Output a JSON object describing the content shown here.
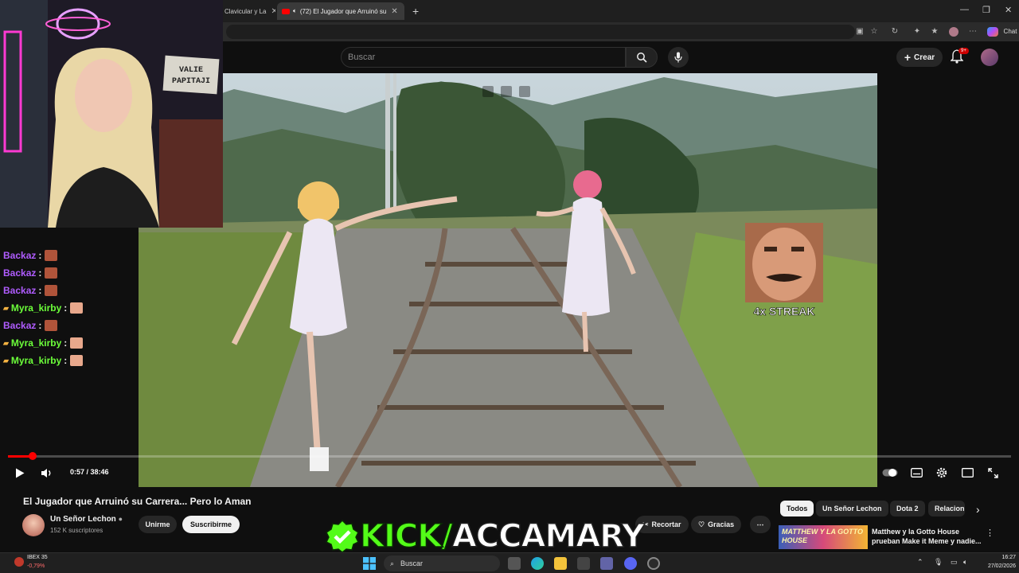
{
  "browser": {
    "tabs": [
      {
        "label": "Clavicular y La",
        "active": false
      },
      {
        "label": "(72) El Jugador que Arruinó su",
        "active": true
      }
    ],
    "new_tab_icon": "plus-icon",
    "chat_label": "Chat"
  },
  "youtube": {
    "search_placeholder": "Buscar",
    "create_label": "Crear",
    "notifications_badge": "9+"
  },
  "video": {
    "overlay_streak_text": "4x STREAK",
    "time_display": "0:57 / 38:46",
    "progress_fraction": 0.0245,
    "title": "El Jugador que Arruinó su Carrera... Pero lo Aman"
  },
  "channel": {
    "name": "Un Señor Lechon",
    "subscribers": "152 K suscriptores",
    "join_label": "Unirme",
    "subscribe_label": "Suscribirme"
  },
  "actions": {
    "clip_label": "Recortar",
    "thanks_label": "Gracias"
  },
  "chips": [
    "Todos",
    "Un Señor Lechon",
    "Dota 2",
    "Relacion"
  ],
  "recommended": {
    "thumb_text": "MATTHEW Y LA GOTTO HOUSE",
    "title": "Matthew y la Gotto House prueban Make it Meme y nadie..."
  },
  "stream": {
    "webcam_sign": "VALIE\nPAPITAJI",
    "chat": [
      {
        "user": "Backaz",
        "color": "#b05cff",
        "sep": ":",
        "emote": "pepe-emote",
        "badge": false
      },
      {
        "user": "Backaz",
        "color": "#b05cff",
        "sep": ":",
        "emote": "pepe-emote",
        "badge": false
      },
      {
        "user": "Backaz",
        "color": "#b05cff",
        "sep": ":",
        "emote": "pepe-emote",
        "badge": false
      },
      {
        "user": "Myra_kirby",
        "color": "#6cff3a",
        "sep": ":",
        "emote": "thumbs-emote",
        "badge": true
      },
      {
        "user": "Backaz",
        "color": "#b05cff",
        "sep": ":",
        "emote": "pepe-emote",
        "badge": false
      },
      {
        "user": "Myra_kirby",
        "color": "#6cff3a",
        "sep": ":",
        "emote": "thumbs-emote",
        "badge": true
      },
      {
        "user": "Myra_kirby",
        "color": "#6cff3a",
        "sep": ":",
        "emote": "thumbs-emote",
        "badge": true
      }
    ],
    "kick_prefix": "KICK/",
    "kick_handle": "ACCAMARY"
  },
  "taskbar": {
    "ticker_name": "IBEX 35",
    "ticker_change": "-0,79%",
    "search_label": "Buscar",
    "time": "16:27",
    "date": "27/02/2026"
  },
  "colors": {
    "youtube_red": "#ff0000",
    "kick_green": "#53fc18",
    "chat_purple": "#b05cff",
    "chat_green": "#6cff3a"
  }
}
